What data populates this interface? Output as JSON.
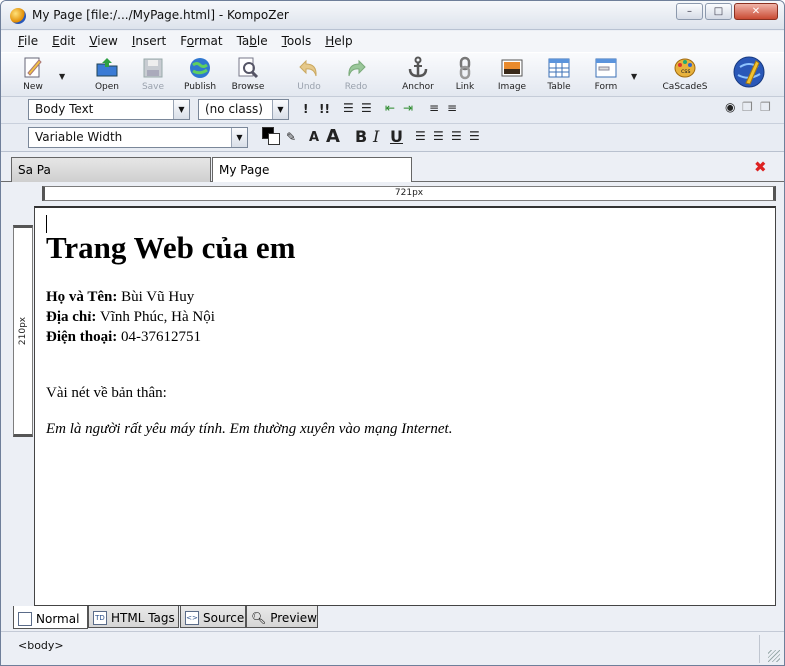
{
  "window": {
    "title": "My Page [file:/.../MyPage.html] - KompoZer",
    "controls": {
      "minimize": "–",
      "maximize": "□",
      "close": "✕"
    }
  },
  "menu": [
    "File",
    "Edit",
    "View",
    "Insert",
    "Format",
    "Table",
    "Tools",
    "Help"
  ],
  "menu_underline": [
    "F",
    "E",
    "V",
    "I",
    "o",
    "b",
    "T",
    "H"
  ],
  "toolbar": {
    "new": "New",
    "open": "Open",
    "save": "Save",
    "publish": "Publish",
    "browse": "Browse",
    "undo": "Undo",
    "redo": "Redo",
    "anchor": "Anchor",
    "link": "Link",
    "image": "Image",
    "table": "Table",
    "form": "Form",
    "cascades": "CaScadeS"
  },
  "format_toolbar": {
    "paragraph_style": "Body Text",
    "class": "(no class)",
    "font": "Variable Width"
  },
  "tabs": {
    "first": "Sa Pa",
    "second": "My Page"
  },
  "ruler": {
    "width_label": "721px",
    "height_label": "210px"
  },
  "document": {
    "heading": "Trang Web của em",
    "name_label": "Họ và Tên:",
    "name_value": " Bùi Vũ Huy",
    "address_label": "Địa chỉ:",
    "address_value": " Vĩnh Phúc, Hà Nội",
    "phone_label": "Điện thoại:",
    "phone_value": " 04-37612751",
    "about_heading": "Vài nét về bản thân:",
    "about_text": "Em là người rất yêu máy tính. Em thường xuyên vào mạng Internet."
  },
  "view_tabs": {
    "normal": "Normal",
    "html_tags": "HTML Tags",
    "source": "Source",
    "preview": "Preview"
  },
  "status": {
    "path": "<body>"
  },
  "colors": {
    "accent": "#2a58b8",
    "close": "#c94a33"
  }
}
